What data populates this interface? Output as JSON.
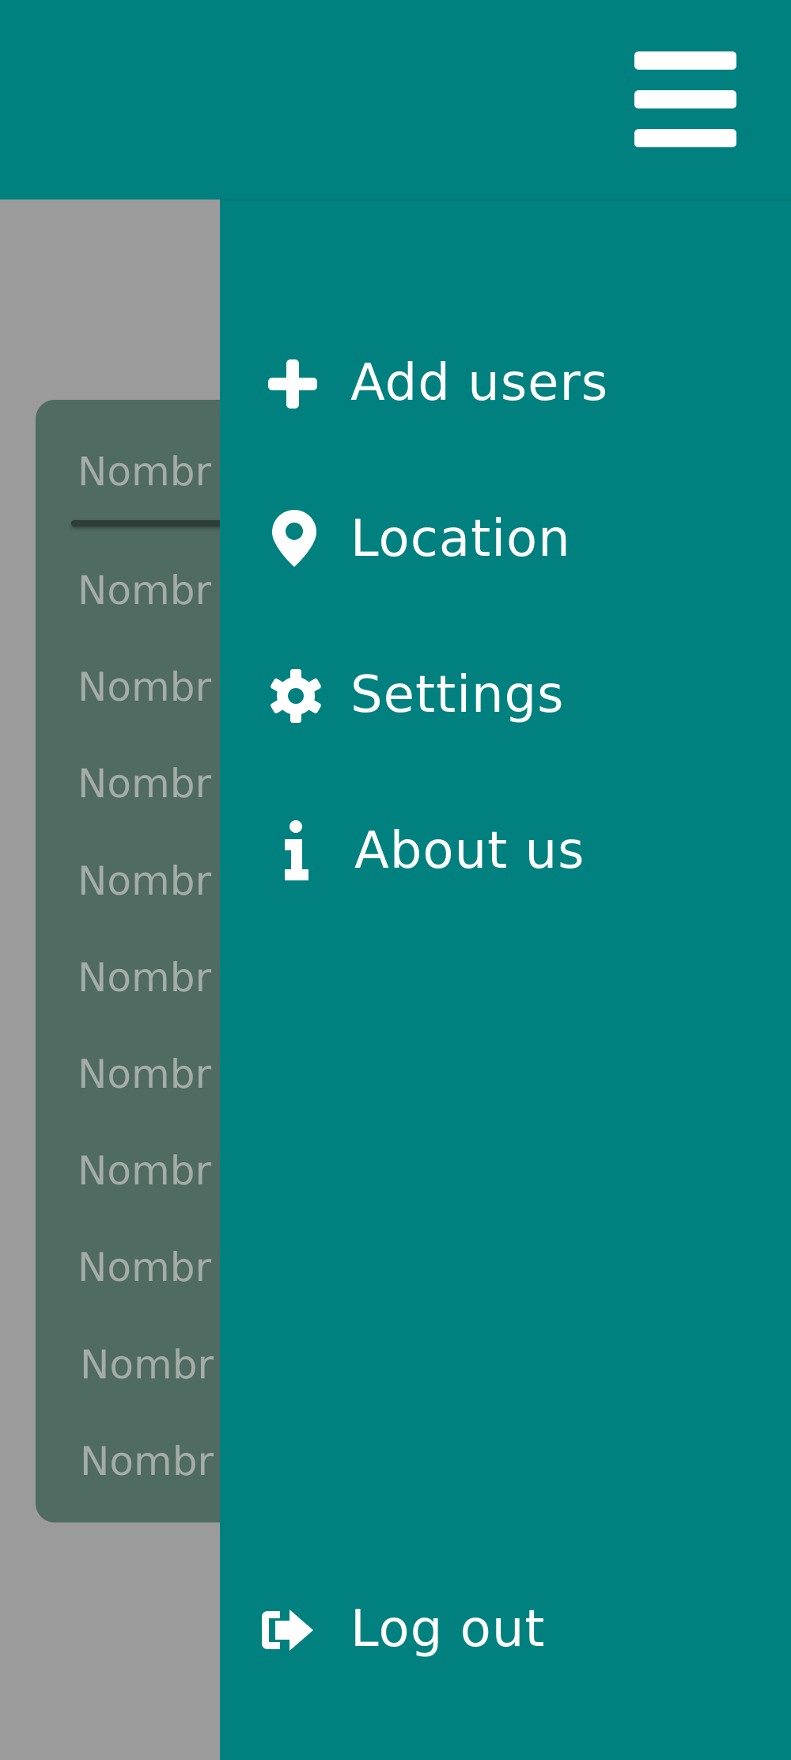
{
  "header": {
    "menu_icon": "hamburger-menu-icon"
  },
  "background_list": {
    "rows": [
      "Nombr",
      "Nombr",
      "Nombr",
      "Nombr",
      "Nombr",
      "Nombr",
      "Nombr",
      "Nombr",
      "Nombr",
      "Nombr",
      "Nombr"
    ]
  },
  "drawer": {
    "items": [
      {
        "label": "Add users",
        "icon": "plus-icon"
      },
      {
        "label": "Location",
        "icon": "location-pin-icon"
      },
      {
        "label": "Settings",
        "icon": "gear-icon"
      },
      {
        "label": "About us",
        "icon": "info-icon"
      }
    ],
    "logout": {
      "label": "Log out",
      "icon": "logout-icon"
    }
  },
  "colors": {
    "primary": "#00817f",
    "scrim": "#9b9b9b",
    "card": "#4f6b62",
    "text_on_primary": "#ffffff"
  }
}
